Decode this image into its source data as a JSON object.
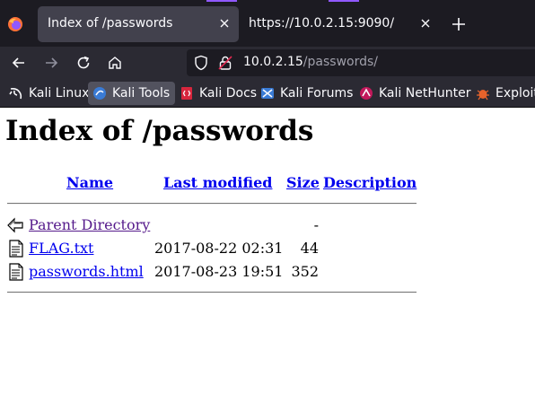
{
  "browser": {
    "tabs": [
      {
        "title": "Index of /passwords",
        "active": true
      },
      {
        "title": "https://10.0.2.15:9090/",
        "active": false
      }
    ],
    "url": {
      "host": "10.0.2.15",
      "path": "/passwords/"
    },
    "bookmarks": [
      "Kali Linux",
      "Kali Tools",
      "Kali Docs",
      "Kali Forums",
      "Kali NetHunter",
      "Exploit-"
    ],
    "colors": {
      "tabstrip": "#1c1b22",
      "toolbar": "#2b2a33",
      "accent": "#9059ff"
    }
  },
  "page": {
    "title": "Index of /passwords",
    "columns": [
      "Name",
      "Last modified",
      "Size",
      "Description"
    ],
    "rows": [
      {
        "name": "Parent Directory",
        "modified": "",
        "size": "-",
        "icon": "back-arrow-icon"
      },
      {
        "name": "FLAG.txt",
        "modified": "2017-08-22 02:31",
        "size": "44",
        "icon": "text-file-icon"
      },
      {
        "name": "passwords.html",
        "modified": "2017-08-23 19:51",
        "size": "352",
        "icon": "text-file-icon"
      }
    ]
  }
}
